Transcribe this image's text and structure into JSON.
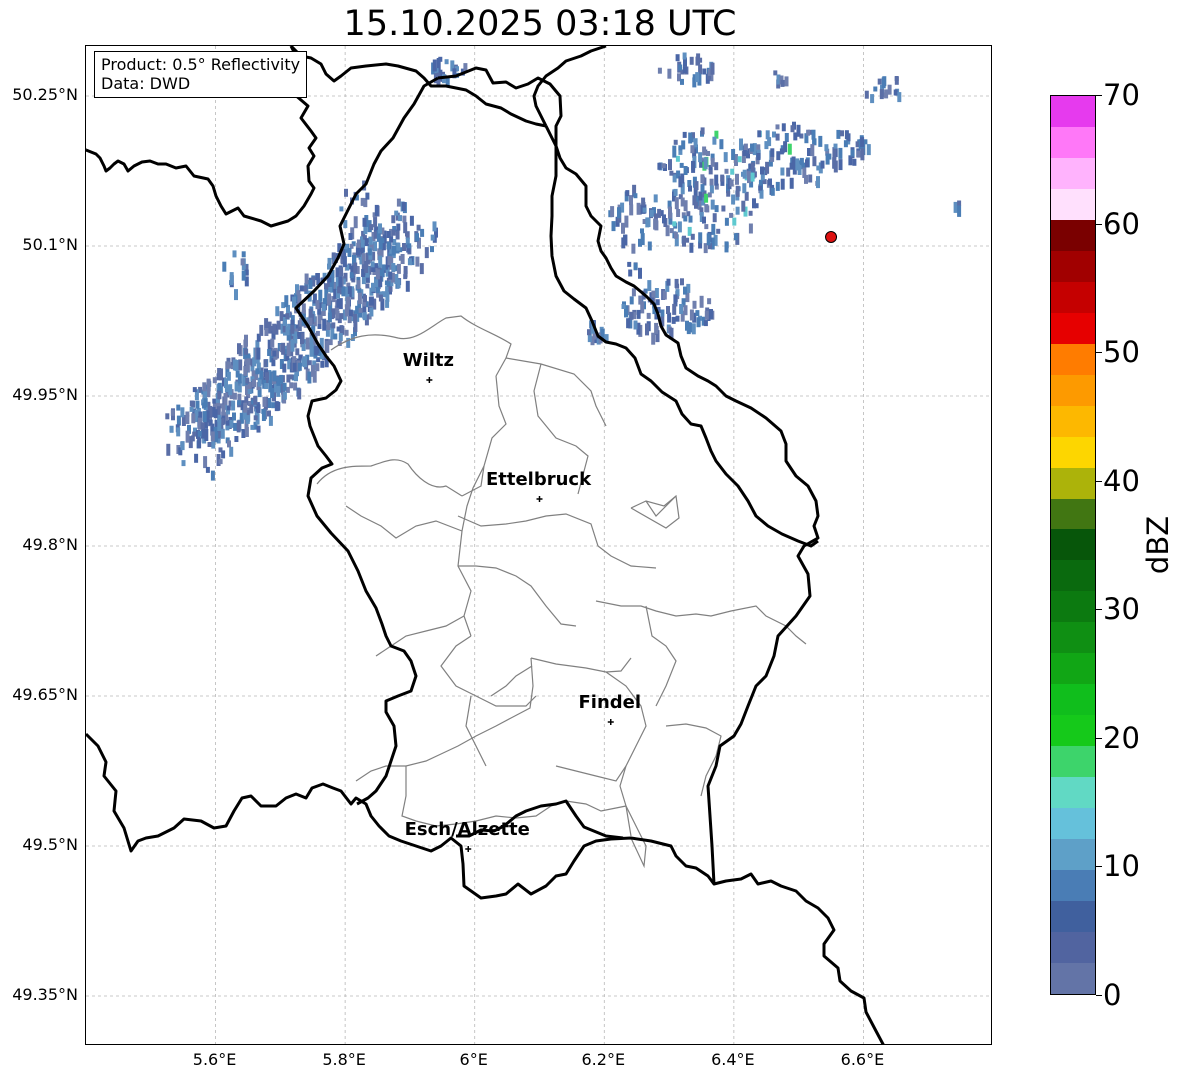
{
  "title": "15.10.2025 03:18 UTC",
  "info": {
    "product": "Product: 0.5° Reflectivity",
    "source": "Data: DWD"
  },
  "lat_labels": [
    "50.25°N",
    "50.1°N",
    "49.95°N",
    "49.8°N",
    "49.65°N",
    "49.5°N",
    "49.35°N"
  ],
  "lon_labels": [
    "5.6°E",
    "5.8°E",
    "6°E",
    "6.2°E",
    "6.4°E",
    "6.6°E"
  ],
  "cities": [
    {
      "name": "Wiltz",
      "lon": 5.93,
      "lat": 49.966
    },
    {
      "name": "Ettelbruck",
      "lon": 6.1,
      "lat": 49.847
    },
    {
      "name": "Findel",
      "lon": 6.21,
      "lat": 49.624
    },
    {
      "name": "Esch/Alzette",
      "lon": 5.99,
      "lat": 49.497
    }
  ],
  "radar_site": {
    "lon": 6.55,
    "lat": 50.109,
    "color": "#dd1111"
  },
  "colorbar": {
    "label": "dBZ",
    "tick_labels": [
      "0",
      "10",
      "20",
      "30",
      "40",
      "50",
      "60",
      "70"
    ],
    "ticks": [
      0,
      10,
      20,
      30,
      40,
      50,
      60,
      70
    ],
    "range": [
      0,
      70
    ],
    "colors": [
      "#6374a7",
      "#5164a0",
      "#40609e",
      "#4a7db5",
      "#5ea0c8",
      "#65c1db",
      "#61d9c4",
      "#3dd46b",
      "#15c91a",
      "#10be1c",
      "#11a615",
      "#0f8f13",
      "#0c7a10",
      "#0a6a0e",
      "#07560a",
      "#417612",
      "#acb30a",
      "#fdd600",
      "#fdb800",
      "#fd9a00",
      "#ff7c00",
      "#e60000",
      "#c50000",
      "#a10000",
      "#7a0000",
      "#ffe0fd",
      "#ffb3fd",
      "#ff78f8",
      "#e63aee"
    ]
  },
  "extent": {
    "lon": [
      5.4,
      6.8
    ],
    "lat": [
      49.3,
      50.3
    ]
  },
  "colors": {
    "border": "#000000",
    "district": "#808080",
    "grid": "#b8b8b8"
  }
}
